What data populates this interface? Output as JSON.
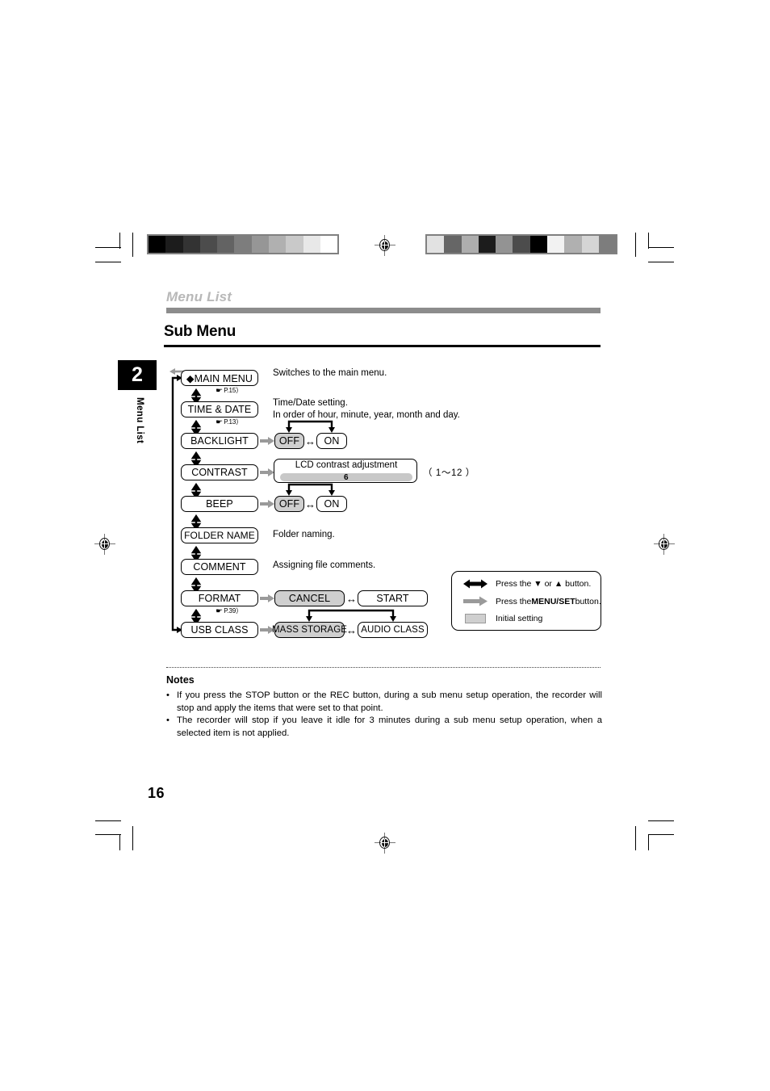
{
  "header": {
    "chapter_label": "Menu List",
    "page_title": "Sub Menu"
  },
  "chapter_tab": {
    "number": "2",
    "label": "Menu List"
  },
  "page_number": "16",
  "flow": {
    "menu_items": [
      {
        "id": "main-menu",
        "label": "◆MAIN MENU",
        "pageref": "P.15",
        "description": "Switches to the main menu."
      },
      {
        "id": "time-date",
        "label": "TIME & DATE",
        "pageref": "P.13",
        "description": "Time/Date setting.\nIn order of hour, minute, year, month and day."
      },
      {
        "id": "backlight",
        "label": "BACKLIGHT",
        "pageref": "",
        "description": "",
        "options": [
          "OFF",
          "ON"
        ],
        "initial": "OFF"
      },
      {
        "id": "contrast",
        "label": "CONTRAST",
        "pageref": "",
        "description": "",
        "slider_title": "LCD contrast adjustment",
        "slider_value": "6",
        "range_label": "（ 1～12 ）"
      },
      {
        "id": "beep",
        "label": "BEEP",
        "pageref": "",
        "description": "",
        "options": [
          "OFF",
          "ON"
        ],
        "initial": "OFF"
      },
      {
        "id": "folder-name",
        "label": "FOLDER NAME",
        "pageref": "",
        "description": "Folder naming."
      },
      {
        "id": "comment",
        "label": "COMMENT",
        "pageref": "",
        "description": "Assigning file comments."
      },
      {
        "id": "format",
        "label": "FORMAT",
        "pageref": "P.39",
        "description": "",
        "options": [
          "CANCEL",
          "START"
        ],
        "initial": "CANCEL"
      },
      {
        "id": "usb-class",
        "label": "USB CLASS",
        "pageref": "",
        "description": "",
        "options": [
          "MASS STORAGE",
          "AUDIO CLASS"
        ],
        "initial": "MASS STORAGE"
      }
    ]
  },
  "legend": {
    "rows": [
      {
        "icon": "double-arrow-icon",
        "text_before": "Press the ▼ or ▲ button.",
        "bold": "",
        "text_after": ""
      },
      {
        "icon": "gray-arrow-icon",
        "text_before": "Press the ",
        "bold": "MENU/SET",
        "text_after": " button."
      },
      {
        "icon": "shaded-swatch-icon",
        "text_before": "Initial setting",
        "bold": "",
        "text_after": ""
      }
    ]
  },
  "notes": {
    "title": "Notes",
    "items": [
      "If you press the STOP button or the REC button, during a sub menu setup operation, the recorder will stop and apply the items that were set to that point.",
      "The recorder will stop if you leave it idle for 3 minutes during a sub menu setup operation, when a selected item is not applied."
    ]
  },
  "print_marks": {
    "gray_strip_left": [
      "#000000",
      "#1c1c1c",
      "#333333",
      "#4c4c4c",
      "#636363",
      "#7d7d7d",
      "#969696",
      "#b0b0b0",
      "#c9c9c9",
      "#e8e8e8",
      "#ffffff"
    ],
    "gray_strip_right": [
      "#e2e2e2",
      "#666666",
      "#aeaeae",
      "#1c1c1c",
      "#939393",
      "#4c4c4c",
      "#000000",
      "#f2f2f2",
      "#b0b0b0",
      "#d5d5d5",
      "#7d7d7d"
    ]
  }
}
